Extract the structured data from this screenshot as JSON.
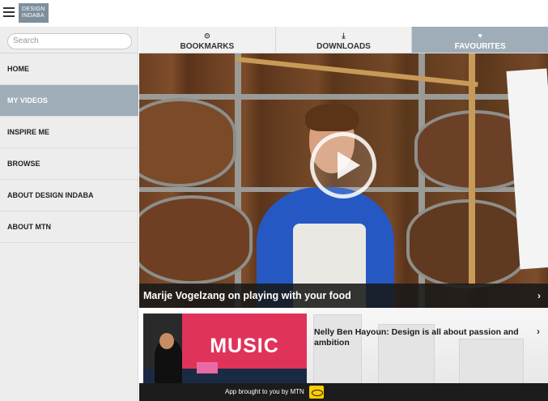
{
  "header": {
    "logo_line1": "DESIGN",
    "logo_line2": "INDABA",
    "menu_icon": "hamburger-menu-icon"
  },
  "sidebar": {
    "search_placeholder": "Search",
    "items": [
      {
        "label": "HOME",
        "active": false
      },
      {
        "label": "MY VIDEOS",
        "active": true
      },
      {
        "label": "INSPIRE ME",
        "active": false
      },
      {
        "label": "BROWSE",
        "active": false
      },
      {
        "label": "ABOUT DESIGN INDABA",
        "active": false
      },
      {
        "label": "ABOUT MTN",
        "active": false
      }
    ]
  },
  "tabs": [
    {
      "label": "BOOKMARKS",
      "icon": "bookmark-icon",
      "glyph": "⊙",
      "active": false
    },
    {
      "label": "DOWNLOADS",
      "icon": "download-icon",
      "glyph": "⤓",
      "active": false
    },
    {
      "label": "FAVOURITES",
      "icon": "heart-icon",
      "glyph": "♥",
      "active": true
    }
  ],
  "main": {
    "featured": {
      "title": "Marije Vogelzang on playing with your food",
      "chevron": "›"
    },
    "list": [
      {
        "title": "Nelly Ben Hayoun: Design is all about passion and ambition",
        "thumbnail_text": "MUSIC",
        "chevron": "›"
      }
    ]
  },
  "footer": {
    "text": "App brought to you by MTN"
  },
  "colors": {
    "accent": "#9eadb7",
    "logo_bg": "#7d8f9c",
    "footer_bg": "#1c1c1c",
    "mtn_yellow": "#ffcc00"
  }
}
